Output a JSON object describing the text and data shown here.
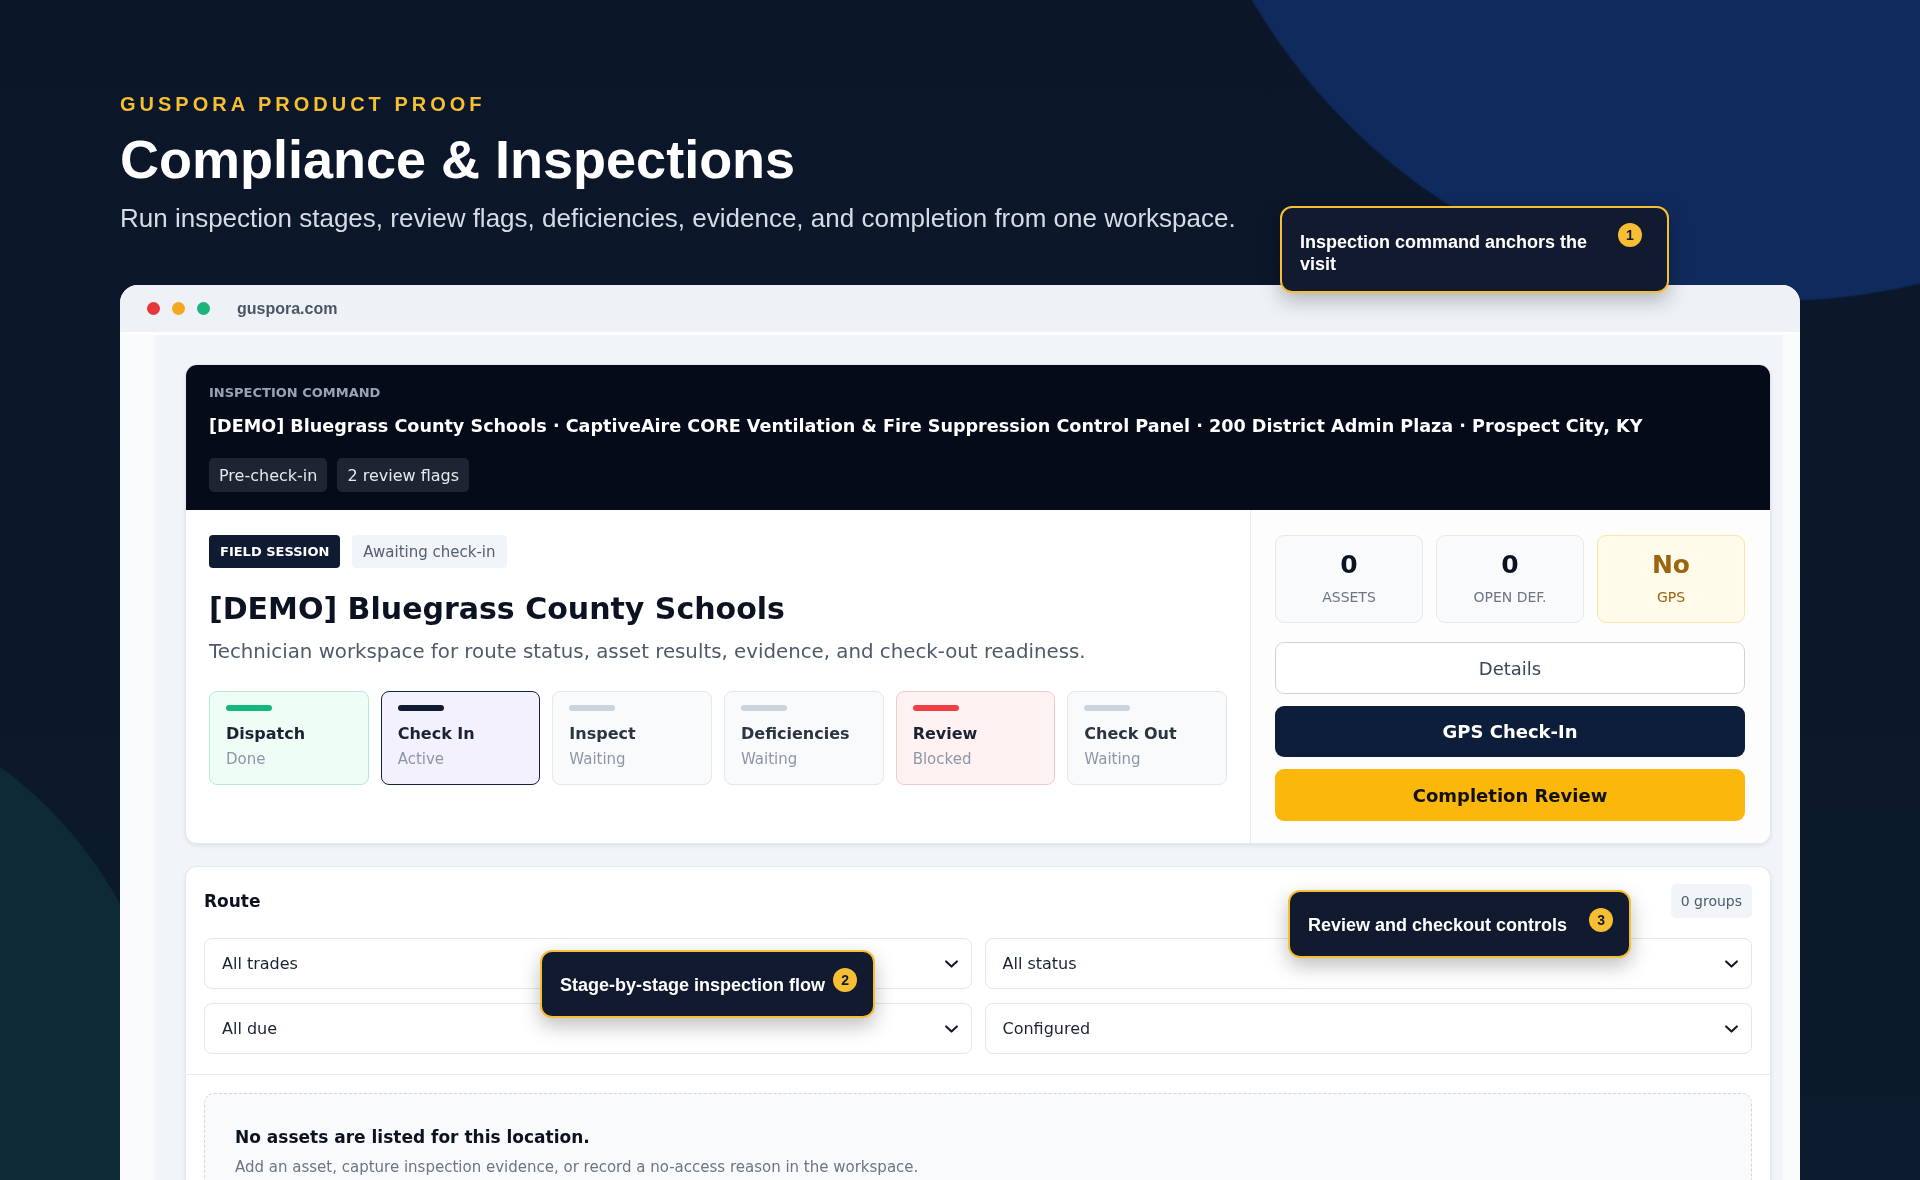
{
  "header": {
    "eyebrow": "GUSPORA PRODUCT PROOF",
    "title": "Compliance & Inspections",
    "subtitle": "Run inspection stages, review flags, deficiencies, evidence, and completion from one workspace."
  },
  "browser": {
    "url": "guspora.com"
  },
  "command": {
    "label": "INSPECTION COMMAND",
    "title": "[DEMO] Bluegrass County Schools · CaptiveAire CORE Ventilation & Fire Suppression Control Panel · 200 District Admin Plaza · Prospect City, KY",
    "chips": [
      "Pre-check-in",
      "2 review flags"
    ]
  },
  "field_session": {
    "badge": "FIELD SESSION",
    "status": "Awaiting check-in",
    "title": "[DEMO] Bluegrass County Schools",
    "description": "Technician workspace for route status, asset results, evidence, and check-out readiness.",
    "stages": [
      {
        "name": "Dispatch",
        "status": "Done",
        "kind": "done"
      },
      {
        "name": "Check In",
        "status": "Active",
        "kind": "active"
      },
      {
        "name": "Inspect",
        "status": "Waiting",
        "kind": "waiting"
      },
      {
        "name": "Deficiencies",
        "status": "Waiting",
        "kind": "waiting"
      },
      {
        "name": "Review",
        "status": "Blocked",
        "kind": "blocked"
      },
      {
        "name": "Check Out",
        "status": "Waiting",
        "kind": "waiting"
      }
    ]
  },
  "stats": [
    {
      "value": "0",
      "label": "ASSETS",
      "kind": "neutral"
    },
    {
      "value": "0",
      "label": "OPEN DEF.",
      "kind": "neutral"
    },
    {
      "value": "No",
      "label": "GPS",
      "kind": "warning"
    }
  ],
  "actions": [
    {
      "label": "Details",
      "kind": "outline"
    },
    {
      "label": "GPS Check-In",
      "kind": "primary"
    },
    {
      "label": "Completion Review",
      "kind": "accent"
    }
  ],
  "route": {
    "title": "Route",
    "count": "0 groups",
    "filters": [
      {
        "value": "All trades"
      },
      {
        "value": "All status"
      },
      {
        "value": "All due"
      },
      {
        "value": "Configured"
      }
    ],
    "empty_state": {
      "title": "No assets are listed for this location.",
      "text": "Add an asset, capture inspection evidence, or record a no-access reason in the workspace."
    }
  },
  "callouts": [
    {
      "number": "1",
      "text": "Inspection command anchors the visit"
    },
    {
      "number": "2",
      "text": "Stage-by-stage inspection flow"
    },
    {
      "number": "3",
      "text": "Review and checkout controls"
    }
  ]
}
